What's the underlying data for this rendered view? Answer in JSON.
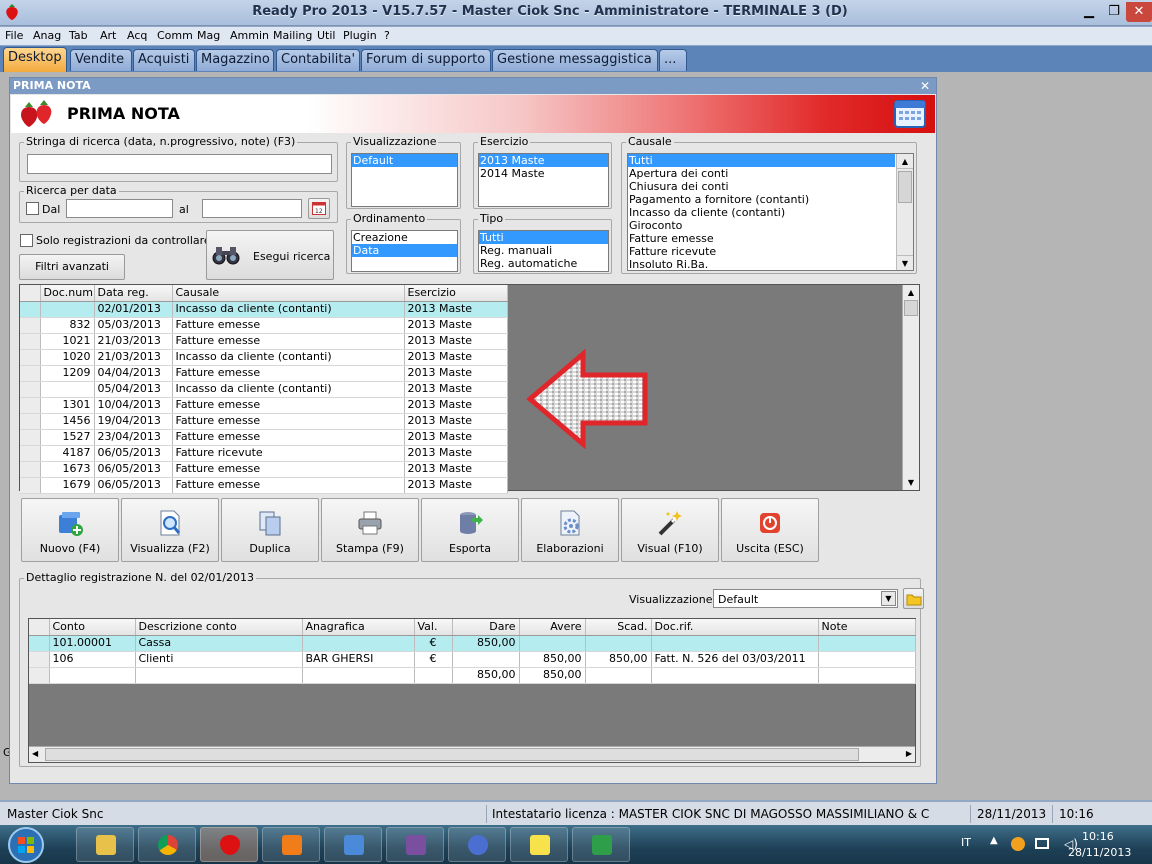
{
  "window_title": "Ready Pro 2013 - V15.7.57 - Master Ciok Snc - Amministratore - TERMINALE 3 (D)",
  "menu": [
    "File",
    "Anag",
    "Tab",
    "Art",
    "Acq",
    "Comm",
    "Mag",
    "Ammin",
    "Mailing",
    "Util",
    "Plugin",
    "?"
  ],
  "tabs": [
    "Desktop",
    "Vendite",
    "Acquisti",
    "Magazzino",
    "Contabilita'",
    "Forum di supporto",
    "Gestione messaggistica",
    "..."
  ],
  "panel": {
    "title": "PRIMA NOTA",
    "heading": "PRIMA NOTA"
  },
  "search": {
    "legend": "Stringa di ricerca (data, n.progressivo, note) (F3)",
    "value": "",
    "date_legend": "Ricerca per data",
    "dal": "Dal",
    "al": "al",
    "solo": "Solo registrazioni da controllare",
    "filtri": "Filtri avanzati",
    "esegui": "Esegui ricerca"
  },
  "visualizzazione": {
    "label": "Visualizzazione",
    "items": [
      "Default"
    ]
  },
  "esercizio": {
    "label": "Esercizio",
    "items": [
      "2013 Maste",
      "2014 Maste"
    ]
  },
  "ordinamento": {
    "label": "Ordinamento",
    "items": [
      "Creazione",
      "Data"
    ]
  },
  "tipo": {
    "label": "Tipo",
    "items": [
      "Tutti",
      "Reg. manuali",
      "Reg. automatiche"
    ]
  },
  "causale": {
    "label": "Causale",
    "items": [
      "Tutti",
      "Apertura dei conti",
      "Chiusura dei conti",
      "Pagamento a fornitore (contanti)",
      "Incasso da cliente (contanti)",
      "Giroconto",
      "Fatture emesse",
      "Fatture ricevute",
      "Insoluto Ri.Ba."
    ]
  },
  "grid": {
    "headers": [
      "Doc.num",
      "Data reg.",
      "Causale",
      "Esercizio"
    ],
    "rows": [
      [
        "",
        "02/01/2013",
        "Incasso da cliente (contanti)",
        "2013 Maste"
      ],
      [
        "832",
        "05/03/2013",
        "Fatture emesse",
        "2013 Maste"
      ],
      [
        "1021",
        "21/03/2013",
        "Fatture emesse",
        "2013 Maste"
      ],
      [
        "1020",
        "21/03/2013",
        "Incasso da cliente (contanti)",
        "2013 Maste"
      ],
      [
        "1209",
        "04/04/2013",
        "Fatture emesse",
        "2013 Maste"
      ],
      [
        "",
        "05/04/2013",
        "Incasso da cliente (contanti)",
        "2013 Maste"
      ],
      [
        "1301",
        "10/04/2013",
        "Fatture emesse",
        "2013 Maste"
      ],
      [
        "1456",
        "19/04/2013",
        "Fatture emesse",
        "2013 Maste"
      ],
      [
        "1527",
        "23/04/2013",
        "Fatture emesse",
        "2013 Maste"
      ],
      [
        "4187",
        "06/05/2013",
        "Fatture ricevute",
        "2013 Maste"
      ],
      [
        "1673",
        "06/05/2013",
        "Fatture emesse",
        "2013 Maste"
      ],
      [
        "1679",
        "06/05/2013",
        "Fatture emesse",
        "2013 Maste"
      ]
    ]
  },
  "toolbar": [
    "Nuovo (F4)",
    "Visualizza (F2)",
    "Duplica",
    "Stampa (F9)",
    "Esporta",
    "Elaborazioni",
    "Visual (F10)",
    "Uscita (ESC)"
  ],
  "detail": {
    "legend": "Dettaglio registrazione N.  del 02/01/2013",
    "vis_label": "Visualizzazione :",
    "vis_value": "Default",
    "headers": [
      "Conto",
      "Descrizione conto",
      "Anagrafica",
      "Val.",
      "Dare",
      "Avere",
      "Scad.",
      "Doc.rif.",
      "Note"
    ],
    "rows": [
      [
        "101.00001",
        "Cassa",
        "",
        "€",
        "850,00",
        "",
        "",
        "",
        ""
      ],
      [
        "106",
        "Clienti",
        "BAR GHERSI",
        "€",
        "",
        "850,00",
        "850,00",
        "Fatt. N. 526 del 03/03/2011",
        ""
      ],
      [
        "",
        "",
        "",
        "",
        "850,00",
        "850,00",
        "",
        "",
        ""
      ]
    ]
  },
  "status": {
    "company": "Master Ciok Snc",
    "license": "Intestatario licenza : MASTER CIOK SNC DI MAGOSSO MASSIMILIANO & C",
    "date": "28/11/2013",
    "time": "10:16"
  },
  "tray": {
    "lang": "IT",
    "time": "10:16",
    "date": "28/11/2013"
  },
  "left_stray": "G",
  "colors": {
    "selection": "#3399ff",
    "row_highlight": "#b5ecf0",
    "banner_red": "#d50f0f",
    "arrow": "#e0262a"
  }
}
